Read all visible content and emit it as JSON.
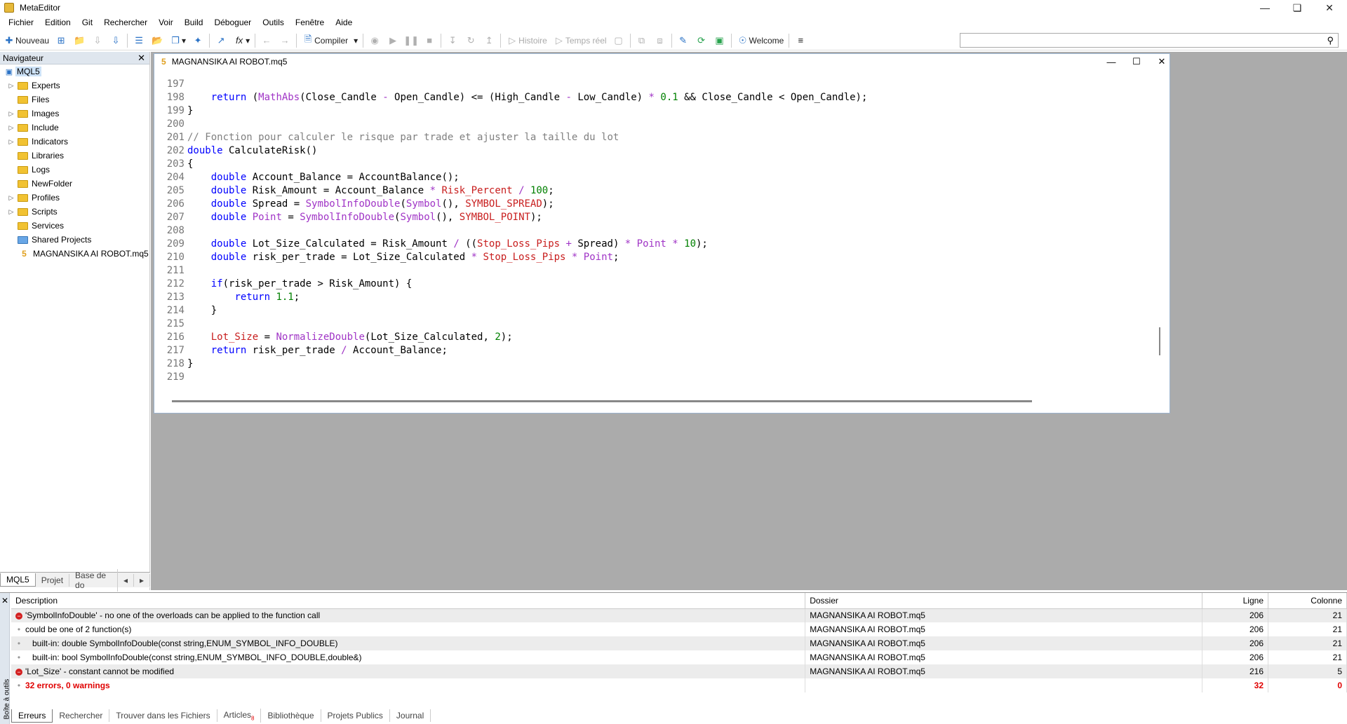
{
  "window": {
    "title": "MetaEditor"
  },
  "menu": [
    "Fichier",
    "Edition",
    "Git",
    "Rechercher",
    "Voir",
    "Build",
    "Déboguer",
    "Outils",
    "Fenêtre",
    "Aide"
  ],
  "toolbar": {
    "new_label": "Nouveau",
    "compile_label": "Compiler",
    "history_label": "Histoire",
    "realtime_label": "Temps réel",
    "welcome_label": "Welcome",
    "search_value": ""
  },
  "navigator": {
    "title": "Navigateur",
    "root": "MQL5",
    "items": [
      {
        "label": "Experts",
        "expandable": true
      },
      {
        "label": "Files",
        "expandable": false
      },
      {
        "label": "Images",
        "expandable": true
      },
      {
        "label": "Include",
        "expandable": true
      },
      {
        "label": "Indicators",
        "expandable": true
      },
      {
        "label": "Libraries",
        "expandable": false
      },
      {
        "label": "Logs",
        "expandable": false
      },
      {
        "label": "NewFolder",
        "expandable": false
      },
      {
        "label": "Profiles",
        "expandable": true
      },
      {
        "label": "Scripts",
        "expandable": true
      },
      {
        "label": "Services",
        "expandable": false
      },
      {
        "label": "Shared Projects",
        "expandable": false
      }
    ],
    "file": "MAGNANSIKA AI ROBOT.mq5",
    "tabs": [
      "MQL5",
      "Projet",
      "Base de do"
    ]
  },
  "editor": {
    "tab_number": "5",
    "filename": "MAGNANSIKA AI ROBOT.mq5",
    "lines": [
      {
        "n": "197",
        "html": ""
      },
      {
        "n": "198",
        "html": "    <span class='kw'>return</span> (<span class='fn'>MathAbs</span>(Close_Candle <span class='op'>-</span> Open_Candle) <= (High_Candle <span class='op'>-</span> Low_Candle) <span class='op'>*</span> <span class='num'>0.1</span> && Close_Candle < Open_Candle);"
      },
      {
        "n": "199",
        "html": "}"
      },
      {
        "n": "200",
        "html": ""
      },
      {
        "n": "201",
        "html": "<span class='cmt'>// Fonction pour calculer le risque par trade et ajuster la taille du lot</span>"
      },
      {
        "n": "202",
        "html": "<span class='kw'>double</span> CalculateRisk()"
      },
      {
        "n": "203",
        "html": "{"
      },
      {
        "n": "204",
        "html": "    <span class='kw'>double</span> Account_Balance = AccountBalance();"
      },
      {
        "n": "205",
        "html": "    <span class='kw'>double</span> Risk_Amount = Account_Balance <span class='op'>*</span> <span class='var'>Risk_Percent</span> <span class='op'>/</span> <span class='num'>100</span>;"
      },
      {
        "n": "206",
        "html": "    <span class='kw'>double</span> Spread = <span class='fn'>SymbolInfoDouble</span>(<span class='fn'>Symbol</span>(), <span class='var'>SYMBOL_SPREAD</span>);"
      },
      {
        "n": "207",
        "html": "    <span class='kw'>double</span> <span class='fn'>Point</span> = <span class='fn'>SymbolInfoDouble</span>(<span class='fn'>Symbol</span>(), <span class='var'>SYMBOL_POINT</span>);"
      },
      {
        "n": "208",
        "html": ""
      },
      {
        "n": "209",
        "html": "    <span class='kw'>double</span> Lot_Size_Calculated = Risk_Amount <span class='op'>/</span> ((<span class='var'>Stop_Loss_Pips</span> <span class='op'>+</span> Spread) <span class='op'>*</span> <span class='fn'>Point</span> <span class='op'>*</span> <span class='num'>10</span>);"
      },
      {
        "n": "210",
        "html": "    <span class='kw'>double</span> risk_per_trade = Lot_Size_Calculated <span class='op'>*</span> <span class='var'>Stop_Loss_Pips</span> <span class='op'>*</span> <span class='fn'>Point</span>;"
      },
      {
        "n": "211",
        "html": ""
      },
      {
        "n": "212",
        "html": "    <span class='kw'>if</span>(risk_per_trade > Risk_Amount) {"
      },
      {
        "n": "213",
        "html": "        <span class='kw'>return</span> <span class='num'>1.1</span>;"
      },
      {
        "n": "214",
        "html": "    }"
      },
      {
        "n": "215",
        "html": ""
      },
      {
        "n": "216",
        "html": "    <span class='var'>Lot_Size</span> = <span class='fn'>NormalizeDouble</span>(Lot_Size_Calculated, <span class='num'>2</span>);"
      },
      {
        "n": "217",
        "html": "    <span class='kw'>return</span> risk_per_trade <span class='op'>/</span> Account_Balance;"
      },
      {
        "n": "218",
        "html": "}"
      },
      {
        "n": "219",
        "html": ""
      }
    ]
  },
  "errors": {
    "columns": [
      "Description",
      "Dossier",
      "Ligne",
      "Colonne"
    ],
    "rows": [
      {
        "type": "error",
        "desc": "'SymbolInfoDouble' - no one of the overloads can be applied to the function call",
        "file": "MAGNANSIKA AI ROBOT.mq5",
        "line": "206",
        "col": "21"
      },
      {
        "type": "info",
        "desc": "could be one of 2 function(s)",
        "file": "MAGNANSIKA AI ROBOT.mq5",
        "line": "206",
        "col": "21"
      },
      {
        "type": "info",
        "desc": "   built-in: double SymbolInfoDouble(const string,ENUM_SYMBOL_INFO_DOUBLE)",
        "file": "MAGNANSIKA AI ROBOT.mq5",
        "line": "206",
        "col": "21"
      },
      {
        "type": "info",
        "desc": "   built-in: bool SymbolInfoDouble(const string,ENUM_SYMBOL_INFO_DOUBLE,double&)",
        "file": "MAGNANSIKA AI ROBOT.mq5",
        "line": "206",
        "col": "21"
      },
      {
        "type": "error",
        "desc": "'Lot_Size' - constant cannot be modified",
        "file": "MAGNANSIKA AI ROBOT.mq5",
        "line": "216",
        "col": "5"
      },
      {
        "type": "summary",
        "desc": "32 errors, 0 warnings",
        "file": "",
        "line": "32",
        "col": "0"
      }
    ],
    "side_label": "Boîte à outils",
    "tabs": [
      "Erreurs",
      "Rechercher",
      "Trouver dans les Fichiers",
      "Articles",
      "Bibliothèque",
      "Projets Publics",
      "Journal"
    ],
    "articles_badge": "8"
  }
}
